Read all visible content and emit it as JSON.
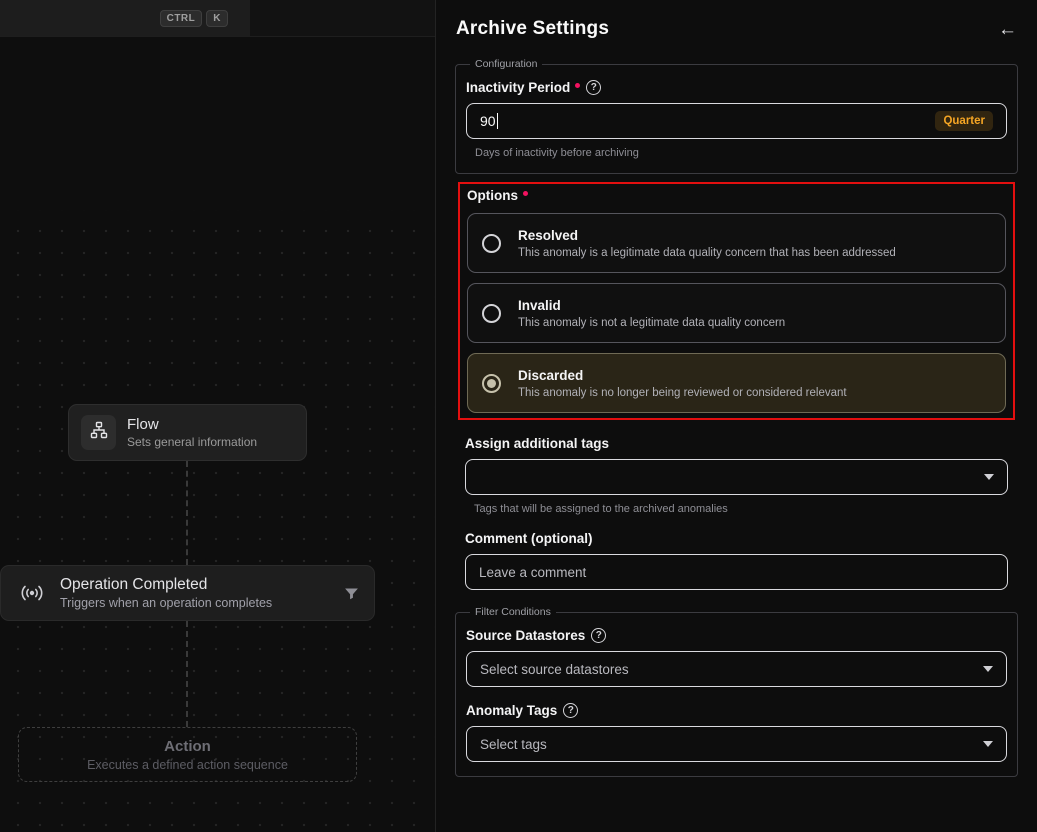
{
  "canvas": {
    "shortcut_keys": {
      "ctrl": "CTRL",
      "k": "K"
    },
    "nodes": {
      "flow": {
        "title": "Flow",
        "subtitle": "Sets general information"
      },
      "operation": {
        "title": "Operation Completed",
        "subtitle": "Triggers when an operation completes"
      },
      "action": {
        "title": "Action",
        "subtitle": "Executes a defined action sequence"
      }
    }
  },
  "panel": {
    "title": "Archive Settings",
    "back_icon": "←",
    "configuration": {
      "legend": "Configuration",
      "inactivity_label": "Inactivity Period",
      "inactivity_value": "90",
      "inactivity_unit": "Quarter",
      "inactivity_help": "Days of inactivity before archiving",
      "help_glyph": "?"
    },
    "options": {
      "label": "Options",
      "items": [
        {
          "title": "Resolved",
          "description": "This anomaly is a legitimate data quality concern that has been addressed",
          "selected": false
        },
        {
          "title": "Invalid",
          "description": "This anomaly is not a legitimate data quality concern",
          "selected": false
        },
        {
          "title": "Discarded",
          "description": "This anomaly is no longer being reviewed or considered relevant",
          "selected": true
        }
      ]
    },
    "tags": {
      "label": "Assign additional tags",
      "help": "Tags that will be assigned to the archived anomalies"
    },
    "comment": {
      "label": "Comment (optional)",
      "placeholder": "Leave a comment"
    },
    "filter": {
      "legend": "Filter Conditions",
      "source_label": "Source Datastores",
      "source_placeholder": "Select source datastores",
      "anomaly_label": "Anomaly Tags",
      "anomaly_placeholder": "Select tags",
      "help_glyph": "?"
    }
  },
  "colors": {
    "accent_orange": "#f5a524",
    "annotation_red": "#e30f0f",
    "required_dot": "#f31260",
    "selected_option_bg": "#2a2517"
  }
}
